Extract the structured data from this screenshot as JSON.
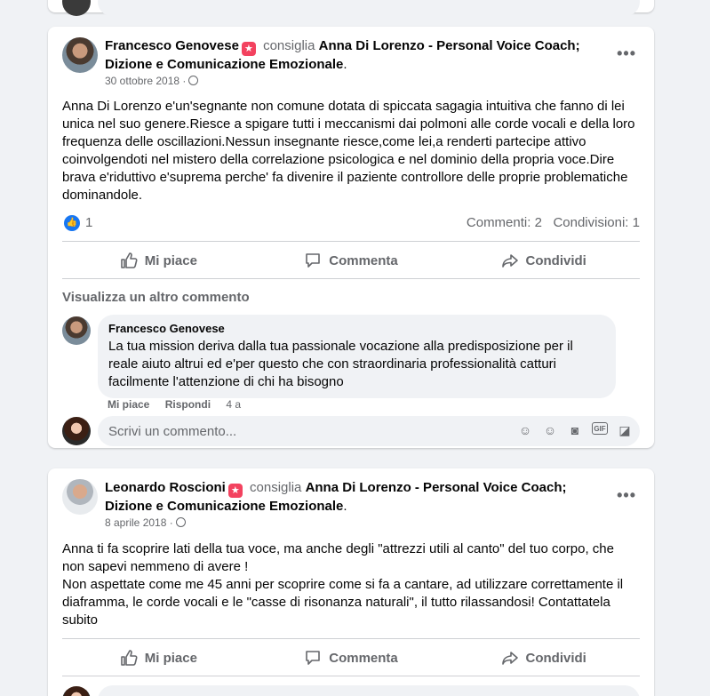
{
  "posts": [
    {
      "author": "Francesco Genovese",
      "recommend_word": "consiglia",
      "page": "Anna Di Lorenzo - Personal Voice Coach; Dizione e Comunicazione Emozionale",
      "period": ".",
      "date": "30 ottobre 2018 ·",
      "text": "Anna Di Lorenzo e'un'segnante non comune dotata di spiccata sagagia intuitiva che fanno di lei unica nel suo genere.Riesce a spigare tutti i meccanismi dai polmoni alle corde vocali e della loro frequenza delle oscillazioni.Nessun insegnante riesce,come lei,a renderti partecipe attivo coinvolgendoti nel mistero della correlazione psicologica  e nel dominio della propria voce.Dire brava e'riduttivo e'suprema perche' fa divenire il paziente controllore delle proprie problematiche dominandole.",
      "likes": "1",
      "comments_count": "Commenti: 2",
      "shares_count": "Condivisioni: 1",
      "more_comments": "Visualizza un altro commento",
      "comment": {
        "author": "Francesco Genovese",
        "text": "La tua mission deriva dalla tua passionale vocazione alla predisposizione per il reale aiuto altrui ed e'per questo che con straordinaria professionalità catturi facilmente l'attenzione di chi ha bisogno",
        "like": "Mi piace",
        "reply": "Rispondi",
        "time": "4 a"
      },
      "write_placeholder": "Scrivi un commento..."
    },
    {
      "author": "Leonardo Roscioni",
      "recommend_word": "consiglia",
      "page": "Anna Di Lorenzo - Personal Voice Coach; Dizione e Comunicazione Emozionale",
      "period": ".",
      "date": "8 aprile 2018 ·",
      "text_lines": [
        "Anna ti fa scoprire lati della tua voce, ma anche degli \"attrezzi utili al canto\" del tuo corpo, che non sapevi nemmeno di avere !",
        "Non aspettate come me 45 anni per scoprire come si fa a cantare, ad utilizzare correttamente il diaframma, le corde vocali e le \"casse di risonanza naturali\", il tutto rilassandosi! Contattatela subito"
      ]
    }
  ],
  "actions": {
    "like": "Mi piace",
    "comment": "Commenta",
    "share": "Condividi"
  },
  "badge_icon": "recommend-star-icon",
  "colors": {
    "accent": "#1877f2",
    "badge": "#f3425f",
    "secondary_text": "#65676b",
    "background": "#f0f2f5"
  }
}
